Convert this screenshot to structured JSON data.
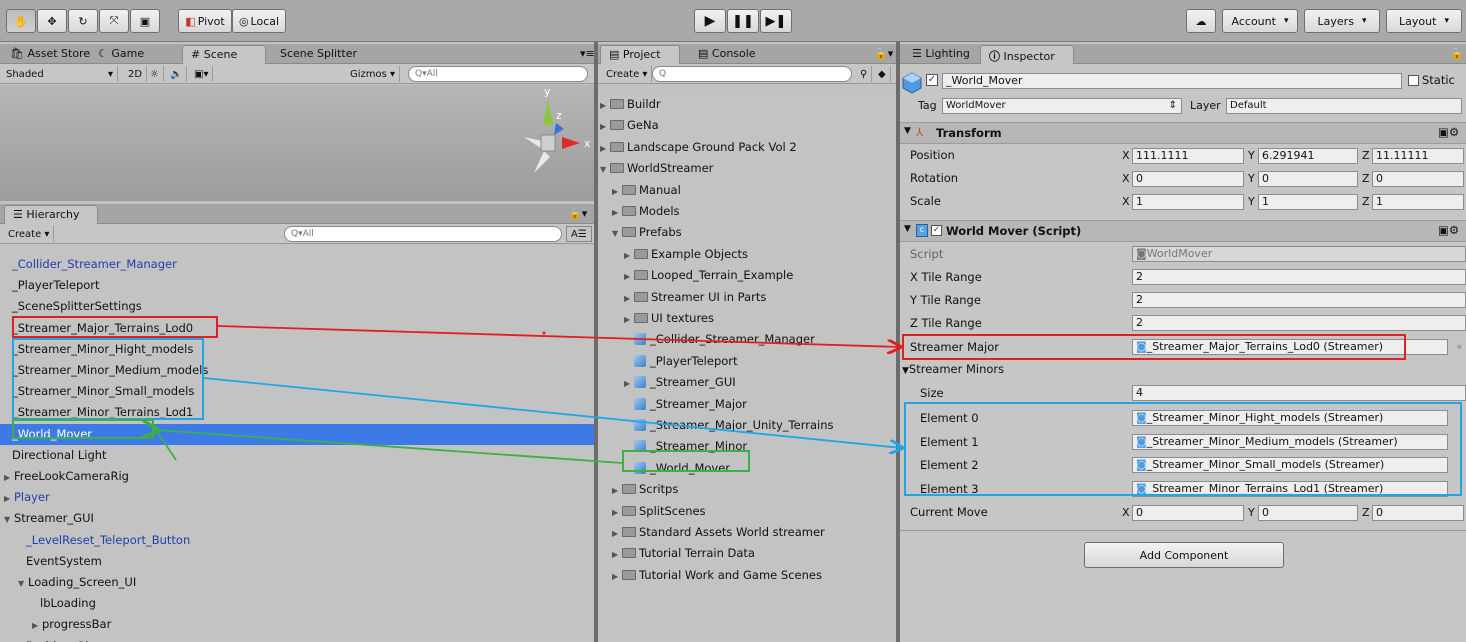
{
  "toolbar": {
    "pivot_label": "Pivot",
    "local_label": "Local",
    "account_label": "Account",
    "layers_label": "Layers",
    "layout_label": "Layout"
  },
  "scene_panel": {
    "tabs": [
      "Asset Store",
      "Game",
      "Scene",
      "Scene Splitter"
    ],
    "shading": "Shaded",
    "mode_2d": "2D",
    "gizmos_label": "Gizmos",
    "search_placeholder": "All",
    "axis_y": "y",
    "axis_z": "z",
    "axis_x": "x"
  },
  "hierarchy": {
    "tab": "Hierarchy",
    "create_label": "Create",
    "search_placeholder": "All",
    "items": [
      {
        "label": "_Collider_Streamer_Manager",
        "color": "blue",
        "indent": 0,
        "arrow": ""
      },
      {
        "label": "_PlayerTeleport",
        "color": "black",
        "indent": 0,
        "arrow": ""
      },
      {
        "label": "_SceneSplitterSettings",
        "color": "black",
        "indent": 0,
        "arrow": ""
      },
      {
        "label": "_Streamer_Major_Terrains_Lod0",
        "color": "black",
        "indent": 0,
        "arrow": ""
      },
      {
        "label": "_Streamer_Minor_Hight_models",
        "color": "black",
        "indent": 0,
        "arrow": ""
      },
      {
        "label": "_Streamer_Minor_Medium_models",
        "color": "black",
        "indent": 0,
        "arrow": ""
      },
      {
        "label": "_Streamer_Minor_Small_models",
        "color": "black",
        "indent": 0,
        "arrow": ""
      },
      {
        "label": "_Streamer_Minor_Terrains_Lod1",
        "color": "black",
        "indent": 0,
        "arrow": ""
      },
      {
        "label": "_World_Mover",
        "color": "selected",
        "indent": 0,
        "arrow": ""
      },
      {
        "label": "Directional Light",
        "color": "black",
        "indent": 0,
        "arrow": ""
      },
      {
        "label": "FreeLookCameraRig",
        "color": "black",
        "indent": 0,
        "arrow": "▶"
      },
      {
        "label": "Player",
        "color": "blue",
        "indent": 0,
        "arrow": "▶"
      },
      {
        "label": "Streamer_GUI",
        "color": "black",
        "indent": 0,
        "arrow": "▼"
      },
      {
        "label": "_LevelReset_Teleport_Button",
        "color": "blue",
        "indent": 1,
        "arrow": ""
      },
      {
        "label": "EventSystem",
        "color": "black",
        "indent": 1,
        "arrow": ""
      },
      {
        "label": "Loading_Screen_UI",
        "color": "black",
        "indent": 1,
        "arrow": "▼"
      },
      {
        "label": "lbLoading",
        "color": "black",
        "indent": 2,
        "arrow": ""
      },
      {
        "label": "progressBar",
        "color": "black",
        "indent": 2,
        "arrow": "▶"
      },
      {
        "label": "Position_Gizmo",
        "color": "black",
        "indent": 1,
        "arrow": ""
      }
    ]
  },
  "project": {
    "tabs": [
      "Project",
      "Console"
    ],
    "create_label": "Create",
    "items": [
      {
        "label": "Buildr",
        "type": "folder",
        "indent": 0,
        "arrow": "▶"
      },
      {
        "label": "GeNa",
        "type": "folder",
        "indent": 0,
        "arrow": "▶"
      },
      {
        "label": "Landscape Ground Pack  Vol 2",
        "type": "folder",
        "indent": 0,
        "arrow": "▶"
      },
      {
        "label": "WorldStreamer",
        "type": "folder",
        "indent": 0,
        "arrow": "▼"
      },
      {
        "label": "Manual",
        "type": "folder",
        "indent": 1,
        "arrow": "▶"
      },
      {
        "label": "Models",
        "type": "folder",
        "indent": 1,
        "arrow": "▶"
      },
      {
        "label": "Prefabs",
        "type": "folder",
        "indent": 1,
        "arrow": "▼"
      },
      {
        "label": "Example Objects",
        "type": "folder",
        "indent": 2,
        "arrow": "▶"
      },
      {
        "label": "Looped_Terrain_Example",
        "type": "folder",
        "indent": 2,
        "arrow": "▶"
      },
      {
        "label": "Streamer UI in Parts",
        "type": "folder",
        "indent": 2,
        "arrow": "▶"
      },
      {
        "label": "UI textures",
        "type": "folder",
        "indent": 2,
        "arrow": "▶"
      },
      {
        "label": "_Collider_Streamer_Manager",
        "type": "prefab",
        "indent": 2,
        "arrow": ""
      },
      {
        "label": "_PlayerTeleport",
        "type": "prefab",
        "indent": 2,
        "arrow": ""
      },
      {
        "label": "_Streamer_GUI",
        "type": "prefab",
        "indent": 2,
        "arrow": "▶"
      },
      {
        "label": "_Streamer_Major",
        "type": "prefab",
        "indent": 2,
        "arrow": ""
      },
      {
        "label": "_Streamer_Major_Unity_Terrains",
        "type": "prefab",
        "indent": 2,
        "arrow": ""
      },
      {
        "label": "_Streamer_Minor",
        "type": "prefab",
        "indent": 2,
        "arrow": ""
      },
      {
        "label": "_World_Mover",
        "type": "prefab",
        "indent": 2,
        "arrow": ""
      },
      {
        "label": "Scritps",
        "type": "folder",
        "indent": 1,
        "arrow": "▶"
      },
      {
        "label": "SplitScenes",
        "type": "folder",
        "indent": 1,
        "arrow": "▶"
      },
      {
        "label": "Standard Assets World streamer",
        "type": "folder",
        "indent": 1,
        "arrow": "▶"
      },
      {
        "label": "Tutorial Terrain Data",
        "type": "folder",
        "indent": 1,
        "arrow": "▶"
      },
      {
        "label": "Tutorial Work and Game Scenes",
        "type": "folder",
        "indent": 1,
        "arrow": "▶"
      }
    ]
  },
  "inspector": {
    "tabs": [
      "Lighting",
      "Inspector"
    ],
    "object_name": "_World_Mover",
    "static_label": "Static",
    "tag_label": "Tag",
    "tag_value": "WorldMover",
    "layer_label": "Layer",
    "layer_value": "Default",
    "transform": {
      "title": "Transform",
      "position_label": "Position",
      "rotation_label": "Rotation",
      "scale_label": "Scale",
      "position": {
        "x": "111.1111",
        "y": "6.291941",
        "z": "11.11111"
      },
      "rotation": {
        "x": "0",
        "y": "0",
        "z": "0"
      },
      "scale": {
        "x": "1",
        "y": "1",
        "z": "1"
      }
    },
    "script": {
      "title": "World Mover (Script)",
      "script_label": "Script",
      "script_value": "WorldMover",
      "x_tile_label": "X Tile Range",
      "x_tile_value": "2",
      "y_tile_label": "Y Tile Range",
      "y_tile_value": "2",
      "z_tile_label": "Z Tile Range",
      "z_tile_value": "2",
      "streamer_major_label": "Streamer Major",
      "streamer_major_value": "_Streamer_Major_Terrains_Lod0 (Streamer)",
      "streamer_minors_label": "Streamer Minors",
      "size_label": "Size",
      "size_value": "4",
      "elements": [
        {
          "label": "Element 0",
          "value": "_Streamer_Minor_Hight_models (Streamer)"
        },
        {
          "label": "Element 1",
          "value": "_Streamer_Minor_Medium_models (Streamer)"
        },
        {
          "label": "Element 2",
          "value": "_Streamer_Minor_Small_models (Streamer)"
        },
        {
          "label": "Element 3",
          "value": "_Streamer_Minor_Terrains_Lod1 (Streamer)"
        }
      ],
      "current_move_label": "Current Move",
      "current_move": {
        "x": "0",
        "y": "0",
        "z": "0"
      }
    },
    "add_component_label": "Add Component"
  },
  "annotation_colors": {
    "red": "#e02020",
    "cyan": "#21a5e6",
    "green": "#3cb043"
  }
}
